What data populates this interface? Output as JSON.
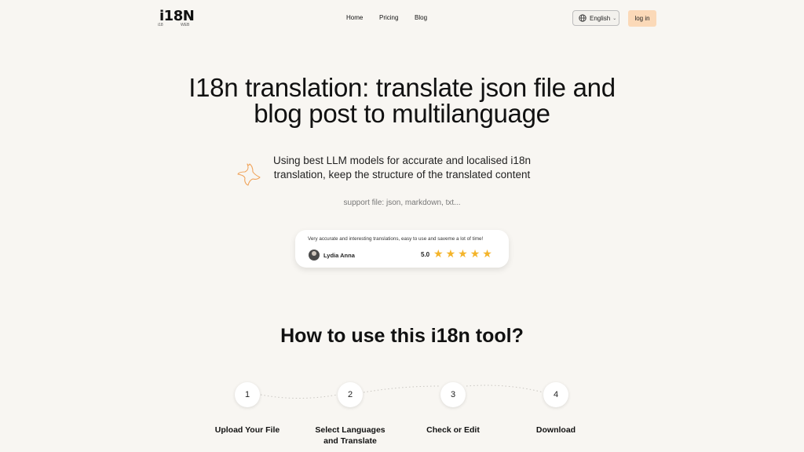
{
  "header": {
    "logo": {
      "main": "i18N",
      "sub_left": "i18",
      "sub_right": "WEB"
    },
    "nav": [
      {
        "label": "Home"
      },
      {
        "label": "Pricing"
      },
      {
        "label": "Blog"
      }
    ],
    "language": {
      "label": "English",
      "icon": "globe-icon"
    },
    "login_label": "log in"
  },
  "hero": {
    "title_line1": "I18n translation: translate json file and",
    "title_line2": "blog post to multilanguage",
    "subtitle_line1": "Using best LLM models for accurate and localised i18n",
    "subtitle_line2": "translation, keep the structure of the translated content",
    "support": "support file: json, markdown, txt..."
  },
  "review": {
    "text": "Very accurate and interesting translations, easy to use and saveme a lot of time!",
    "reviewer": "Lydia Anna",
    "rating": "5.0",
    "stars": 5
  },
  "how_to": {
    "title": "How to use this i18n tool?",
    "steps": [
      {
        "number": "1",
        "label_line1": "Upload Your File",
        "label_line2": ""
      },
      {
        "number": "2",
        "label_line1": "Select Languages",
        "label_line2": "and Translate"
      },
      {
        "number": "3",
        "label_line1": "Check or Edit",
        "label_line2": ""
      },
      {
        "number": "4",
        "label_line1": "Download",
        "label_line2": ""
      }
    ]
  },
  "colors": {
    "background": "#f8f6f2",
    "accent": "#fbd9b8",
    "star": "#f4b42a",
    "sparkle": "#f0a35a"
  }
}
